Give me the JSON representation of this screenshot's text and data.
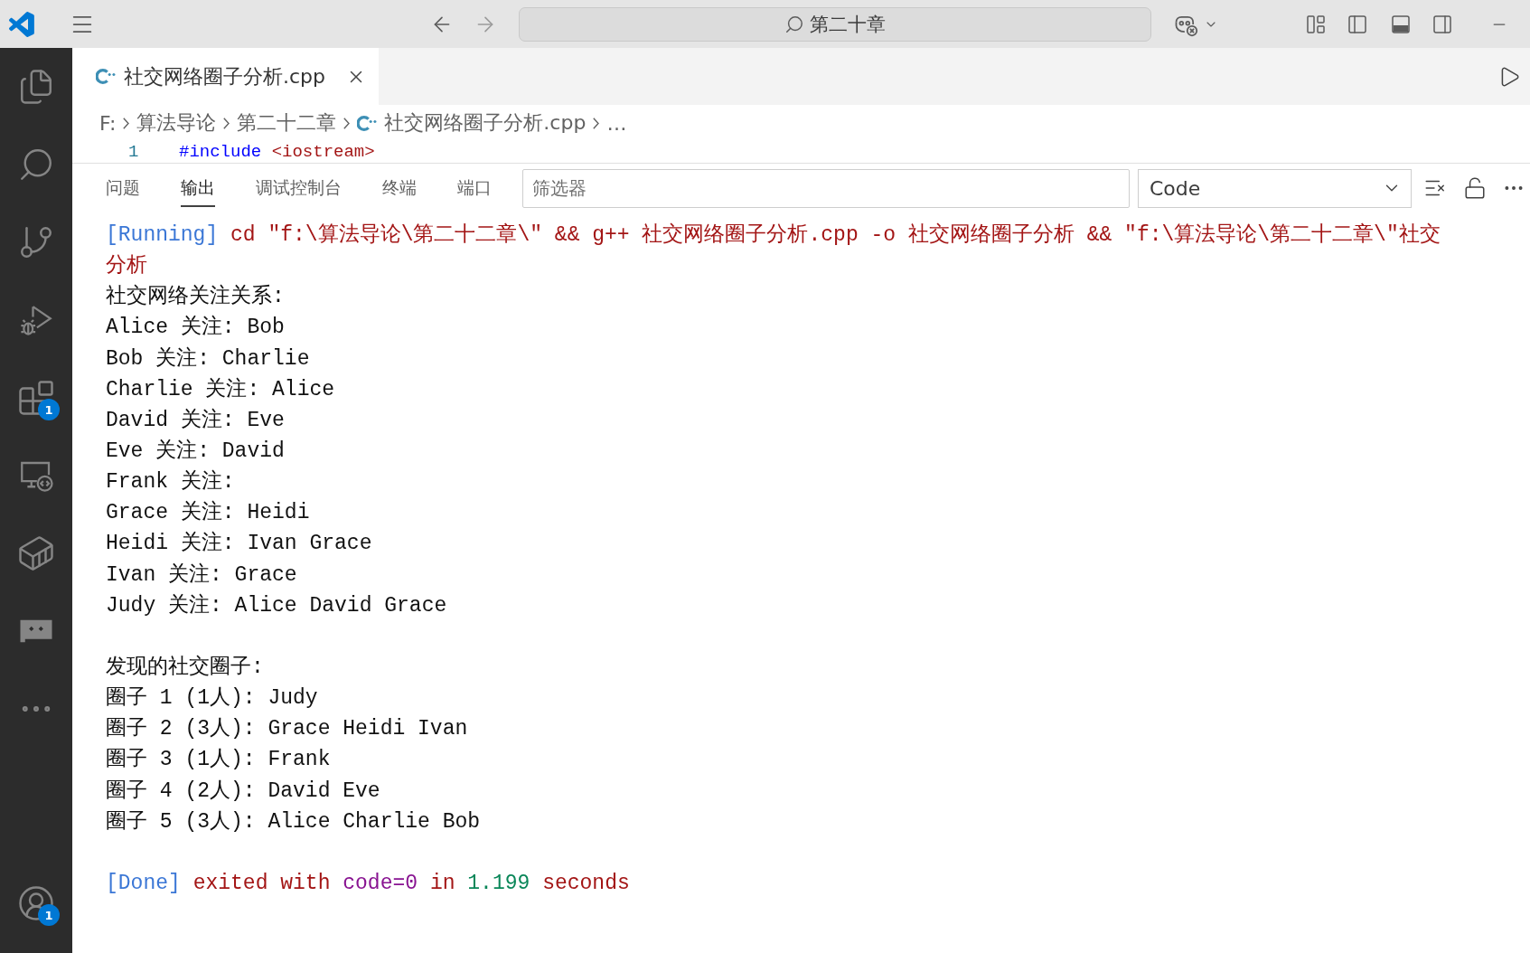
{
  "title_bar": {
    "command_center": {
      "label": "第二十章"
    }
  },
  "activity_bar": {
    "extensions_badge": "1",
    "accounts_badge": "1"
  },
  "editor_tabs": [
    {
      "label": "社交网络圈子分析.cpp",
      "selected": true
    }
  ],
  "breadcrumbs": [
    {
      "kind": "folder",
      "label": "F:"
    },
    {
      "kind": "folder",
      "label": "算法导论"
    },
    {
      "kind": "folder",
      "label": "第二十二章"
    },
    {
      "kind": "file",
      "label": "社交网络圈子分析.cpp"
    },
    {
      "kind": "more",
      "label": "…"
    }
  ],
  "editor": {
    "lines": [
      {
        "number": "1",
        "segments": [
          {
            "kind": "directive",
            "text": "#include "
          },
          {
            "kind": "string",
            "text": "<iostream>"
          }
        ]
      }
    ]
  },
  "panel": {
    "tabs": [
      {
        "label": "问题",
        "selected": false
      },
      {
        "label": "输出",
        "selected": true
      },
      {
        "label": "调试控制台",
        "selected": false
      },
      {
        "label": "终端",
        "selected": false
      },
      {
        "label": "端口",
        "selected": false
      }
    ],
    "filter": {
      "placeholder": "筛选器"
    },
    "channel": {
      "value": "Code"
    },
    "output": [
      {
        "kind": "log",
        "segments": [
          {
            "kind": "tag",
            "text": "[Running]"
          },
          {
            "kind": "command",
            "text": " cd \"f:\\算法导论\\第二十二章\\\" && g++ 社交网络圈子分析.cpp -o 社交网络圈子分析 && \"f:\\算法导论\\第二十二章\\\"社交"
          }
        ]
      },
      {
        "kind": "log",
        "segments": [
          {
            "kind": "command",
            "text": "分析"
          }
        ]
      },
      {
        "kind": "text",
        "text": "社交网络关注关系:"
      },
      {
        "kind": "text",
        "text": "Alice 关注: Bob"
      },
      {
        "kind": "text",
        "text": "Bob 关注: Charlie"
      },
      {
        "kind": "text",
        "text": "Charlie 关注: Alice"
      },
      {
        "kind": "text",
        "text": "David 关注: Eve"
      },
      {
        "kind": "text",
        "text": "Eve 关注: David"
      },
      {
        "kind": "text",
        "text": "Frank 关注:"
      },
      {
        "kind": "text",
        "text": "Grace 关注: Heidi"
      },
      {
        "kind": "text",
        "text": "Heidi 关注: Ivan Grace"
      },
      {
        "kind": "text",
        "text": "Ivan 关注: Grace"
      },
      {
        "kind": "text",
        "text": "Judy 关注: Alice David Grace"
      },
      {
        "kind": "blank"
      },
      {
        "kind": "text",
        "text": "发现的社交圈子:"
      },
      {
        "kind": "text",
        "text": "圈子 1 (1人): Judy"
      },
      {
        "kind": "text",
        "text": "圈子 2 (3人): Grace Heidi Ivan"
      },
      {
        "kind": "text",
        "text": "圈子 3 (1人): Frank"
      },
      {
        "kind": "text",
        "text": "圈子 4 (2人): David Eve"
      },
      {
        "kind": "text",
        "text": "圈子 5 (3人): Alice Charlie Bob"
      },
      {
        "kind": "blank"
      },
      {
        "kind": "log",
        "segments": [
          {
            "kind": "tag",
            "text": "[Done]"
          },
          {
            "kind": "command",
            "text": " exited with "
          },
          {
            "kind": "exit_code",
            "text": "code=0"
          },
          {
            "kind": "command",
            "text": " in "
          },
          {
            "kind": "duration",
            "text": "1.199"
          },
          {
            "kind": "command",
            "text": " seconds"
          }
        ]
      }
    ]
  }
}
